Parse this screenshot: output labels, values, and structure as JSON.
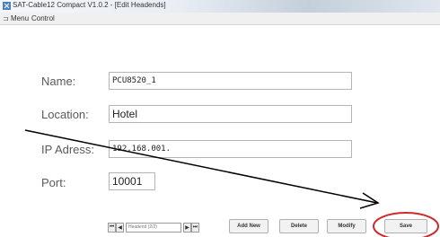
{
  "window": {
    "title": "SAT-Cable12 Compact V1.0.2 - [Edit Headends]",
    "icon": "app-icon"
  },
  "menu": {
    "icon": "menu-icon",
    "items": [
      {
        "label": "Menu"
      },
      {
        "label": "Control"
      }
    ]
  },
  "form": {
    "name_label": "Name:",
    "name_value": "PCU8520_1",
    "location_label": "Location:",
    "location_value": "Hotel",
    "ip_label": "IP Adress:",
    "ip_value": "192.168.001.",
    "port_label": "Port:",
    "port_value": "10001"
  },
  "navigator": {
    "first_icon": "first-record-icon",
    "prev_icon": "prev-record-icon",
    "next_icon": "next-record-icon",
    "last_icon": "last-record-icon",
    "position_text": "Headend (2/2)"
  },
  "buttons": {
    "add_new": "Add New",
    "delete": "Delete",
    "modify": "Modify",
    "save": "Save"
  },
  "annotations": {
    "arrow_color": "#000000",
    "highlight_color": "#d42a2a"
  }
}
